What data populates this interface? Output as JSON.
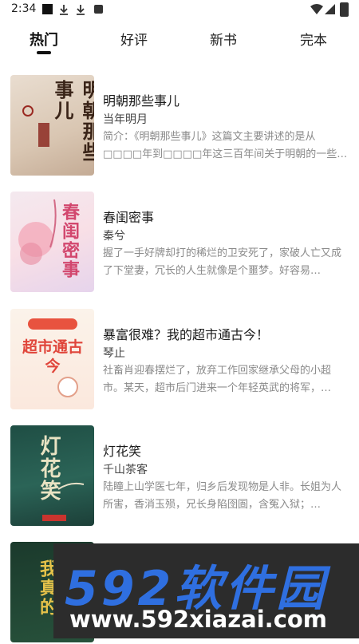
{
  "status_bar": {
    "time": "2:34",
    "icons": [
      "notification-square-icon",
      "download-icon",
      "download-icon",
      "a-icon",
      "wifi-icon",
      "signal-icon",
      "battery-icon"
    ]
  },
  "tabs": [
    {
      "label": "热门",
      "active": true
    },
    {
      "label": "好评",
      "active": false
    },
    {
      "label": "新书",
      "active": false
    },
    {
      "label": "完本",
      "active": false
    }
  ],
  "books": [
    {
      "title": "明朝那些事儿",
      "author": "当年明月",
      "description": "简介：《明朝那些事儿》这篇文主要讲述的是从□□□□年到□□□□年这三百年间关于明朝的一些事…",
      "cover_text": "明朝那些事儿"
    },
    {
      "title": "春闺密事",
      "author": "秦兮",
      "description": "握了一手好牌却打的稀烂的卫安死了，家破人亡又成了下堂妻，冗长的人生就像是个噩梦。好容易…",
      "cover_text": "春闺密事"
    },
    {
      "title": "暴富很难？我的超市通古今！",
      "author": "琴止",
      "description": "社畜肖迎春摆烂了，放弃工作回家继承父母的小超市。某天，超市后门进来一个年轻英武的将军，…",
      "cover_text": "超市通古今"
    },
    {
      "title": "灯花笑",
      "author": "千山茶客",
      "description": "陆瞳上山学医七年，归乡后发现物是人非。长姐为人所害，香消玉殒，兄长身陷囹圄，含冤入狱；…",
      "cover_text": "灯花笑"
    },
    {
      "title": "",
      "author": "",
      "description": "",
      "cover_text": "我真的"
    }
  ],
  "watermark": {
    "brand": "592软件园",
    "url": "www.592xiazai.com"
  },
  "colors": {
    "accent": "#111111",
    "secondary_text": "#8a8a8a",
    "watermark_blue": "#2f6fe0"
  }
}
